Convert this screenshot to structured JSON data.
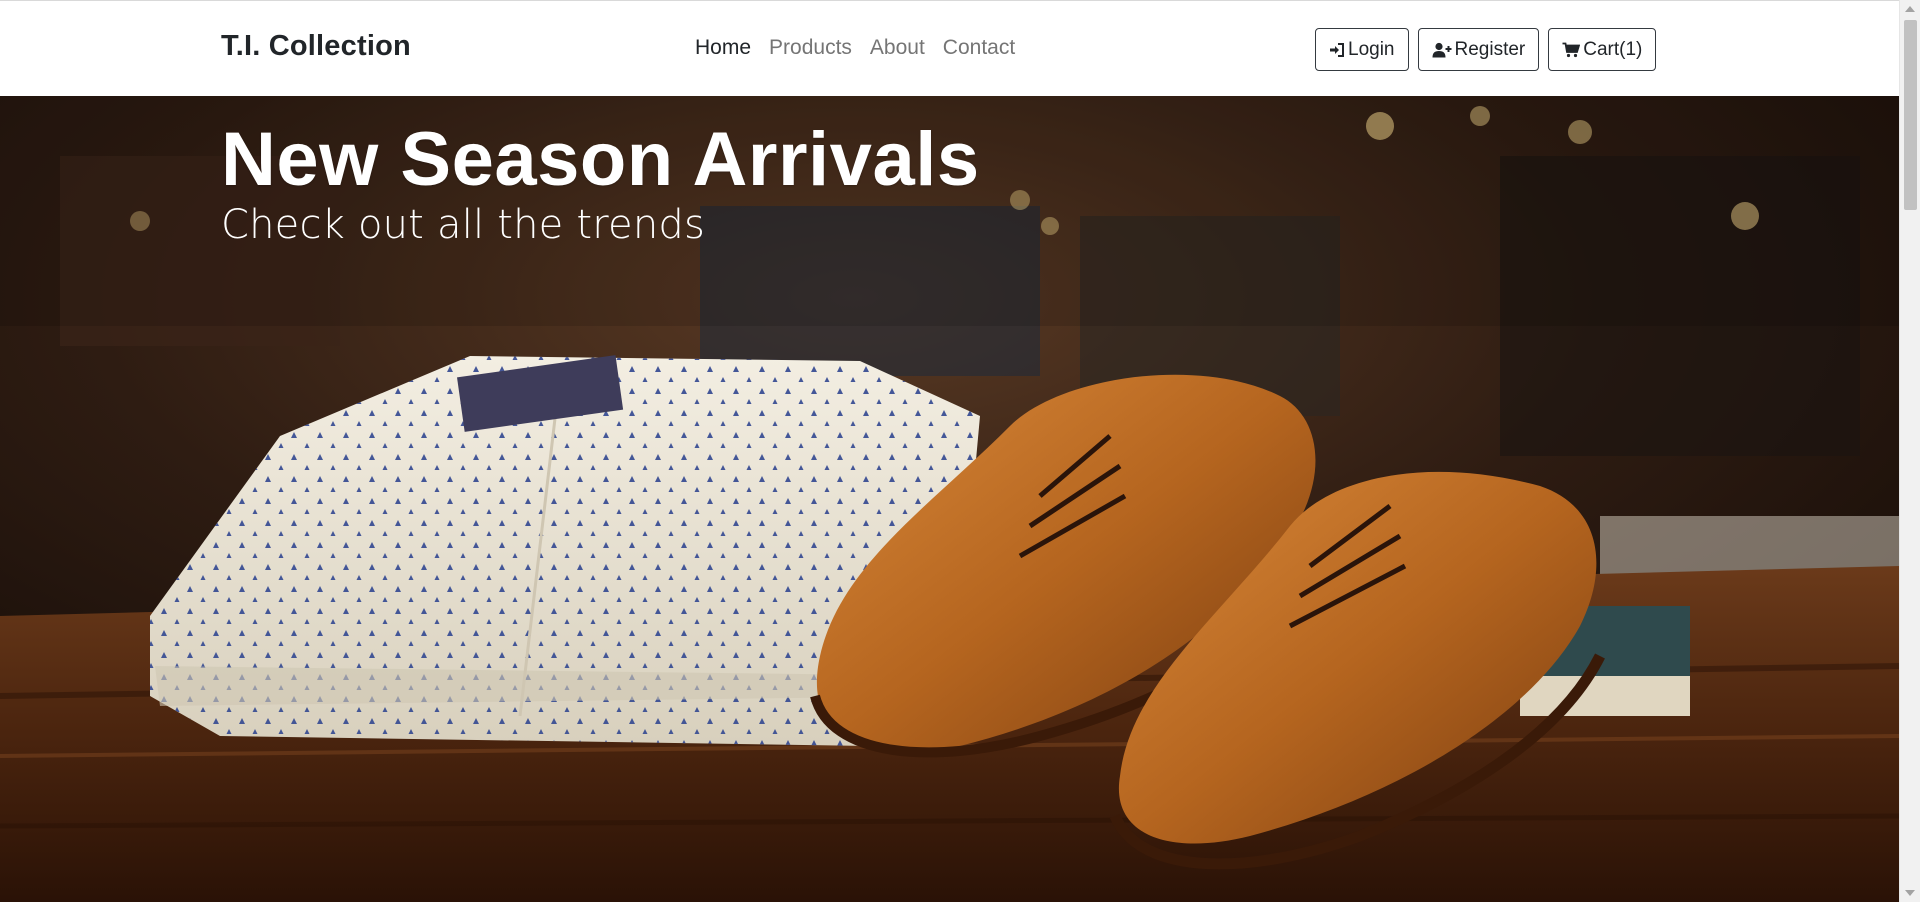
{
  "navbar": {
    "brand": "T.I. Collection",
    "links": [
      {
        "label": "Home",
        "active": true
      },
      {
        "label": "Products",
        "active": false
      },
      {
        "label": "About",
        "active": false
      },
      {
        "label": "Contact",
        "active": false
      }
    ],
    "buttons": {
      "login": {
        "label": "Login",
        "icon": "sign-in-icon"
      },
      "register": {
        "label": "Register",
        "icon": "user-plus-icon"
      },
      "cart": {
        "label": "Cart(1)",
        "icon": "cart-icon"
      }
    }
  },
  "hero": {
    "title": "New Season Arrivals",
    "subtitle": "Check out all the trends"
  },
  "colors": {
    "text_dark": "#212529",
    "nav_muted": "#757575",
    "hero_text": "#ffffff",
    "button_border": "#343a40"
  }
}
